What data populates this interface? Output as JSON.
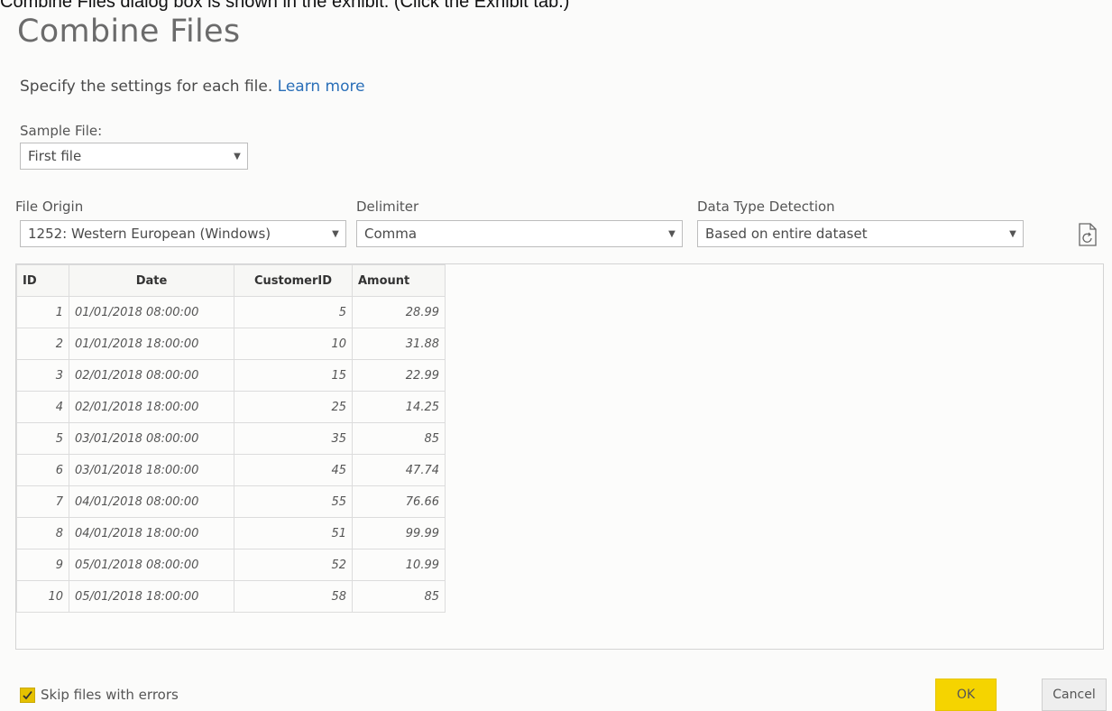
{
  "caption": "Combine Files dialog box is shown in the exhibit. (Click the Exhibit tab.)",
  "dialog": {
    "title": "Combine Files",
    "subtitle": "Specify the settings for each file.",
    "learn_more": "Learn more",
    "sample_file": {
      "label": "Sample File:",
      "value": "First file"
    },
    "file_origin": {
      "label": "File Origin",
      "value": "1252: Western European (Windows)"
    },
    "delimiter": {
      "label": "Delimiter",
      "value": "Comma"
    },
    "data_type_detection": {
      "label": "Data Type Detection",
      "value": "Based on entire dataset"
    },
    "refresh_icon": "refresh-document-icon"
  },
  "table": {
    "headers": [
      "ID",
      "Date",
      "CustomerID",
      "Amount"
    ],
    "rows": [
      [
        "1",
        "01/01/2018 08:00:00",
        "5",
        "28.99"
      ],
      [
        "2",
        "01/01/2018 18:00:00",
        "10",
        "31.88"
      ],
      [
        "3",
        "02/01/2018 08:00:00",
        "15",
        "22.99"
      ],
      [
        "4",
        "02/01/2018 18:00:00",
        "25",
        "14.25"
      ],
      [
        "5",
        "03/01/2018 08:00:00",
        "35",
        "85"
      ],
      [
        "6",
        "03/01/2018 18:00:00",
        "45",
        "47.74"
      ],
      [
        "7",
        "04/01/2018 08:00:00",
        "55",
        "76.66"
      ],
      [
        "8",
        "04/01/2018 18:00:00",
        "51",
        "99.99"
      ],
      [
        "9",
        "05/01/2018 08:00:00",
        "52",
        "10.99"
      ],
      [
        "10",
        "05/01/2018 18:00:00",
        "58",
        "85"
      ]
    ]
  },
  "footer": {
    "skip_errors_label": "Skip files with errors",
    "skip_errors_checked": true,
    "ok_label": "OK",
    "cancel_label": "Cancel"
  },
  "colors": {
    "accent": "#f5d400",
    "link": "#2a6fb8"
  }
}
